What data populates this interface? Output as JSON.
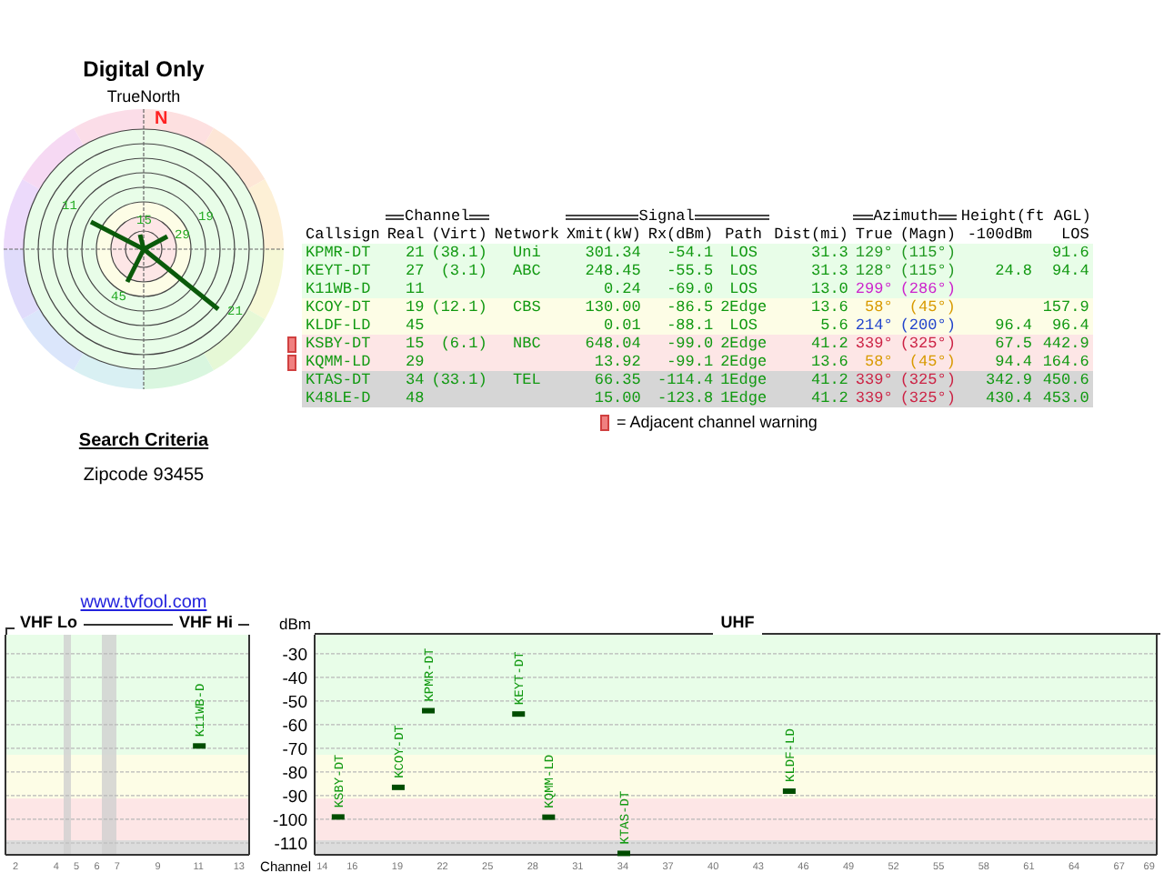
{
  "left": {
    "title": "Digital Only",
    "polar": {
      "north_label": "TrueNorth",
      "n_mark": "N",
      "labels": [
        "11",
        "15",
        "19",
        "29",
        "21",
        "45"
      ]
    },
    "search_heading": "Search Criteria",
    "search_value": "Zipcode 93455",
    "link": "www.tvfool.com"
  },
  "table": {
    "columns": [
      {
        "label": "Callsign"
      },
      {
        "group": "Channel",
        "decorated": true,
        "columns": [
          "Real",
          "(Virt)"
        ]
      },
      {
        "label": "Network"
      },
      {
        "group": "Signal",
        "decorated": true,
        "columns": [
          "Xmit(kW)",
          "Rx(dBm)",
          "Path"
        ]
      },
      {
        "label": "Dist(mi)"
      },
      {
        "group": "Azimuth",
        "decorated": true,
        "columns": [
          "True",
          "(Magn)"
        ]
      },
      {
        "group": "Height(ft AGL)",
        "columns": [
          "-100dBm",
          "LOS"
        ]
      }
    ],
    "rows": [
      {
        "callsign": "KPMR-DT",
        "real": "21",
        "virt": "(38.1)",
        "network": "Uni",
        "xmit": "301.34",
        "rx": "-54.1",
        "path": "LOS",
        "dist": "31.3",
        "azimuth": {
          "true": "129°",
          "magn": "(115°)",
          "color": "#229922"
        },
        "los": "91.6",
        "color": "#e8fde8",
        "adjacent_warning": false
      },
      {
        "callsign": "KEYT-DT",
        "real": "27",
        "virt": "(3.1)",
        "network": "ABC",
        "xmit": "248.45",
        "rx": "-55.5",
        "path": "LOS",
        "dist": "31.3",
        "azimuth": {
          "true": "128°",
          "magn": "(115°)",
          "color": "#229922"
        },
        "height_100": "24.8",
        "los": "94.4",
        "color": "#e8fde8",
        "adjacent_warning": false
      },
      {
        "callsign": "K11WB-D",
        "real": "11",
        "xmit": "0.24",
        "rx": "-69.0",
        "path": "LOS",
        "dist": "13.0",
        "azimuth": {
          "true": "299°",
          "magn": "(286°)",
          "color": "#cc22cc"
        },
        "color": "#e8fde8",
        "adjacent_warning": false
      },
      {
        "callsign": "KCOY-DT",
        "real": "19",
        "virt": "(12.1)",
        "network": "CBS",
        "xmit": "130.00",
        "rx": "-86.5",
        "path": "2Edge",
        "dist": "13.6",
        "azimuth": {
          "true": "58°",
          "magn": "(45°)",
          "color": "#d89a00"
        },
        "los": "157.9",
        "color": "#fdfde6",
        "adjacent_warning": false
      },
      {
        "callsign": "KLDF-LD",
        "real": "45",
        "xmit": "0.01",
        "rx": "-88.1",
        "path": "LOS",
        "dist": "5.6",
        "azimuth": {
          "true": "214°",
          "magn": "(200°)",
          "color": "#2244cc"
        },
        "height_100": "96.4",
        "los": "96.4",
        "color": "#fdfde6",
        "adjacent_warning": false
      },
      {
        "callsign": "KSBY-DT",
        "real": "15",
        "virt": "(6.1)",
        "network": "NBC",
        "xmit": "648.04",
        "rx": "-99.0",
        "path": "2Edge",
        "dist": "41.2",
        "azimuth": {
          "true": "339°",
          "magn": "(325°)",
          "color": "#cc2244"
        },
        "height_100": "67.5",
        "los": "442.9",
        "color": "#fde6e6",
        "adjacent_warning": true
      },
      {
        "callsign": "KQMM-LD",
        "real": "29",
        "xmit": "13.92",
        "rx": "-99.1",
        "path": "2Edge",
        "dist": "13.6",
        "azimuth": {
          "true": "58°",
          "magn": "(45°)",
          "color": "#d89a00"
        },
        "height_100": "94.4",
        "los": "164.6",
        "color": "#fde6e6",
        "adjacent_warning": true
      },
      {
        "callsign": "KTAS-DT",
        "real": "34",
        "virt": "(33.1)",
        "network": "TEL",
        "xmit": "66.35",
        "rx": "-114.4",
        "path": "1Edge",
        "dist": "41.2",
        "azimuth": {
          "true": "339°",
          "magn": "(325°)",
          "color": "#cc2244"
        },
        "height_100": "342.9",
        "los": "450.6",
        "color": "#d6d6d6",
        "adjacent_warning": false
      },
      {
        "callsign": "K48LE-D",
        "real": "48",
        "xmit": "15.00",
        "rx": "-123.8",
        "path": "1Edge",
        "dist": "41.2",
        "azimuth": {
          "true": "339°",
          "magn": "(325°)",
          "color": "#cc2244"
        },
        "height_100": "430.4",
        "los": "453.0",
        "color": "#d6d6d6",
        "adjacent_warning": false
      }
    ]
  },
  "legend": {
    "text": "= Adjacent channel warning"
  },
  "spectrum": {
    "vhf": {
      "band_labels": [
        "VHF Lo",
        "VHF Hi"
      ],
      "chart_data": {
        "type": "scatter",
        "xlabel": "Channel",
        "ylabel": "dBm",
        "xlim": [
          1.5,
          13.5
        ],
        "ylim": [
          -115,
          -22
        ],
        "grid": true,
        "xticks": [
          2,
          4,
          5,
          6,
          7,
          9,
          11,
          13
        ],
        "yticks": [
          -30,
          -40,
          -50,
          -60,
          -70,
          -80,
          -90,
          -100,
          -110
        ],
        "series": [
          {
            "color": "#004d00",
            "x": [
              11
            ],
            "values": [
              -69.0
            ]
          }
        ],
        "annotations": [
          {
            "x": 11,
            "y": -69.0,
            "text": "K11WB-D"
          }
        ]
      }
    },
    "uhf": {
      "chart_data": {
        "type": "scatter",
        "title": "UHF",
        "xlim": [
          13.5,
          69.5
        ],
        "ylim": [
          -115,
          -22
        ],
        "grid": true,
        "xticks": [
          14,
          16,
          19,
          22,
          25,
          28,
          31,
          34,
          37,
          40,
          43,
          46,
          49,
          52,
          55,
          58,
          61,
          64,
          67,
          69
        ],
        "series": [
          {
            "color": "#004d00",
            "x": [
              15,
              19,
              21,
              27,
              29,
              34,
              45
            ],
            "values": [
              -99.0,
              -86.5,
              -54.1,
              -55.5,
              -99.1,
              -114.4,
              -88.1
            ]
          }
        ],
        "annotations": [
          {
            "x": 15,
            "y": -99.0,
            "text": "KSBY-DT"
          },
          {
            "x": 19,
            "y": -86.5,
            "text": "KCOY-DT"
          },
          {
            "x": 21,
            "y": -54.1,
            "text": "KPMR-DT"
          },
          {
            "x": 27,
            "y": -55.5,
            "text": "KEYT-DT"
          },
          {
            "x": 29,
            "y": -99.1,
            "text": "KQMM-LD"
          },
          {
            "x": 34,
            "y": -114.4,
            "text": "KTAS-DT"
          },
          {
            "x": 45,
            "y": -88.1,
            "text": "KLDF-LD"
          }
        ]
      }
    }
  }
}
